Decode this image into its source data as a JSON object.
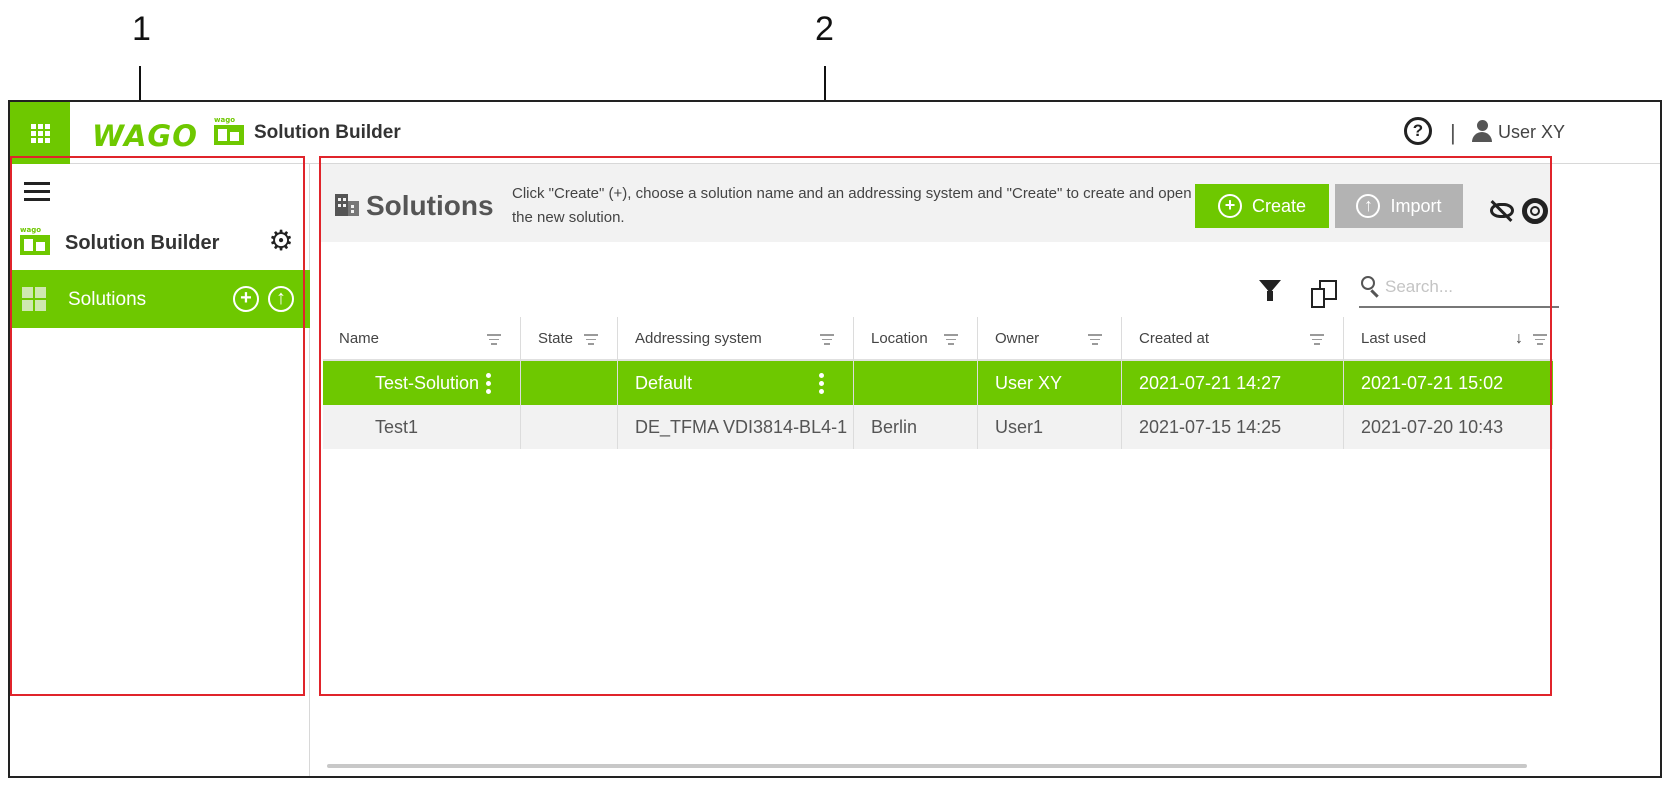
{
  "callouts": {
    "one": "1",
    "two": "2"
  },
  "topbar": {
    "logo": "WAGO",
    "app_title": "Solution Builder",
    "separator": "|",
    "user_name": "User XY",
    "help_icon_text": "?"
  },
  "sidebar": {
    "header_title": "Solution Builder",
    "item": {
      "label": "Solutions",
      "add_icon_text": "+",
      "upload_icon_text": "↑"
    }
  },
  "main": {
    "title": "Solutions",
    "description": "Click \"Create\" (+), choose a solution name and an addressing system and \"Create\" to create and open the new solution.",
    "create_label": "Create",
    "import_label": "Import",
    "search_placeholder": "Search..."
  },
  "table": {
    "columns": [
      "Name",
      "State",
      "Addressing system",
      "Location",
      "Owner",
      "Created at",
      "Last used"
    ],
    "rows": [
      {
        "name": "Test-Solution",
        "state": "",
        "addressing": "Default",
        "location": "",
        "owner": "User XY",
        "created": "2021-07-21 14:27",
        "last_used": "2021-07-21 15:02"
      },
      {
        "name": "Test1",
        "state": "",
        "addressing": "DE_TFMA VDI3814-BL4-1",
        "location": "Berlin",
        "owner": "User1",
        "created": "2021-07-15 14:25",
        "last_used": "2021-07-20 10:43"
      }
    ]
  },
  "colors": {
    "accent": "#6ec800",
    "import_button": "#b3b3b3",
    "highlight_box": "#e0242b"
  }
}
